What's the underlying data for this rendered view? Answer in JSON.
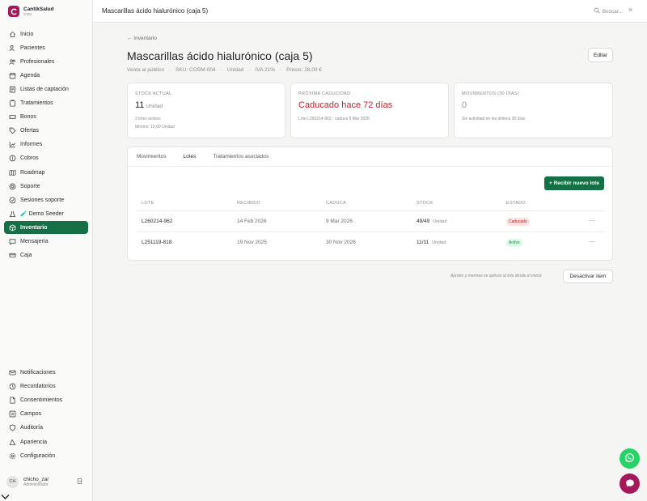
{
  "colors": {
    "brand": "#a3195b",
    "accent": "#157046",
    "danger": "#c8232c",
    "whatsapp": "#25d366"
  },
  "brand": {
    "name": "CantikSalud",
    "sub": "CSM"
  },
  "sidebar": {
    "items": [
      {
        "label": "Inicio",
        "icon": "home-icon"
      },
      {
        "label": "Pacientes",
        "icon": "users-icon"
      },
      {
        "label": "Profesionales",
        "icon": "user-group-icon"
      },
      {
        "label": "Agenda",
        "icon": "calendar-icon"
      },
      {
        "label": "Listas de captación",
        "icon": "list-icon"
      },
      {
        "label": "Tratamientos",
        "icon": "clipboard-icon"
      },
      {
        "label": "Bonos",
        "icon": "ticket-icon"
      },
      {
        "label": "Ofertas",
        "icon": "tag-icon"
      },
      {
        "label": "Informes",
        "icon": "chart-icon"
      },
      {
        "label": "Cobros",
        "icon": "coin-icon"
      },
      {
        "label": "Roadmap",
        "icon": "map-icon"
      },
      {
        "label": "Soporte",
        "icon": "support-icon"
      },
      {
        "label": "Sesiones soporte",
        "icon": "sessions-icon"
      },
      {
        "label": "🧪 Demo Seeder",
        "icon": "flask-icon"
      },
      {
        "label": "Inventario",
        "icon": "box-icon",
        "active": true
      },
      {
        "label": "Mensajería",
        "icon": "message-icon"
      },
      {
        "label": "Caja",
        "icon": "cash-icon"
      }
    ],
    "bottom_items": [
      {
        "label": "Notificaciones",
        "icon": "mail-icon"
      },
      {
        "label": "Recordatorios",
        "icon": "clock-icon"
      },
      {
        "label": "Consentimientos",
        "icon": "document-icon"
      },
      {
        "label": "Campos",
        "icon": "fields-icon"
      },
      {
        "label": "Auditoría",
        "icon": "shield-icon"
      },
      {
        "label": "Apariencia",
        "icon": "palette-icon"
      },
      {
        "label": "Configuración",
        "icon": "gear-icon"
      }
    ],
    "user": {
      "initials": "CH",
      "name": "chicho_zar",
      "role": "Administrador"
    }
  },
  "topbar": {
    "title": "Mascarillas ácido hialurónico (caja 5)",
    "search_placeholder": "Buscar...",
    "shortcut": "⌘"
  },
  "page": {
    "back_label": "← Inventario",
    "title": "Mascarillas ácido hialurónico (caja 5)",
    "meta": [
      "Venta al público",
      "SKU: COSM-004",
      "Unidad",
      "IVA 21%",
      "Precio: 28,00 €"
    ],
    "edit_label": "Editar"
  },
  "cards": {
    "stock": {
      "label": "STOCK ACTUAL",
      "value": "11",
      "unit": "Unidad",
      "sub1": "2 lotes activos",
      "sub2": "Mínimo: 10,00 Unidad"
    },
    "expiry": {
      "label": "PRÓXIMA CADUCIDAD",
      "value": "Caducado hace 72 días",
      "sub1": "Lote L260214-962 · caduca 9 Mar 2026"
    },
    "movements": {
      "label": "MOVIMIENTOS (30 DÍAS)",
      "value": "0",
      "sub1": "Sin actividad en los últimos 30 días"
    }
  },
  "tabs": [
    "Movimientos",
    "Lotes",
    "Tratamientos asociados"
  ],
  "receive_label": "+ Recibir nuevo lote",
  "table": {
    "headers": [
      "LOTE",
      "RECIBIDO",
      "CADUCA",
      "STOCK",
      "ESTADO"
    ],
    "rows": [
      {
        "lote": "L260214-962",
        "recibido": "14 Feb 2026",
        "caduca": "9 Mar 2026",
        "stock": "49/49",
        "unit": "Unidad",
        "estado": "Caducado"
      },
      {
        "lote": "L251119-818",
        "recibido": "19 Nov 2025",
        "caduca": "30 Nov 2026",
        "stock": "11/11",
        "unit": "Unidad",
        "estado": "Activo"
      }
    ]
  },
  "footer": {
    "note": "Ajustes y mermas se aplican al lote desde el menú",
    "deactivate_label": "Desactivar item"
  }
}
